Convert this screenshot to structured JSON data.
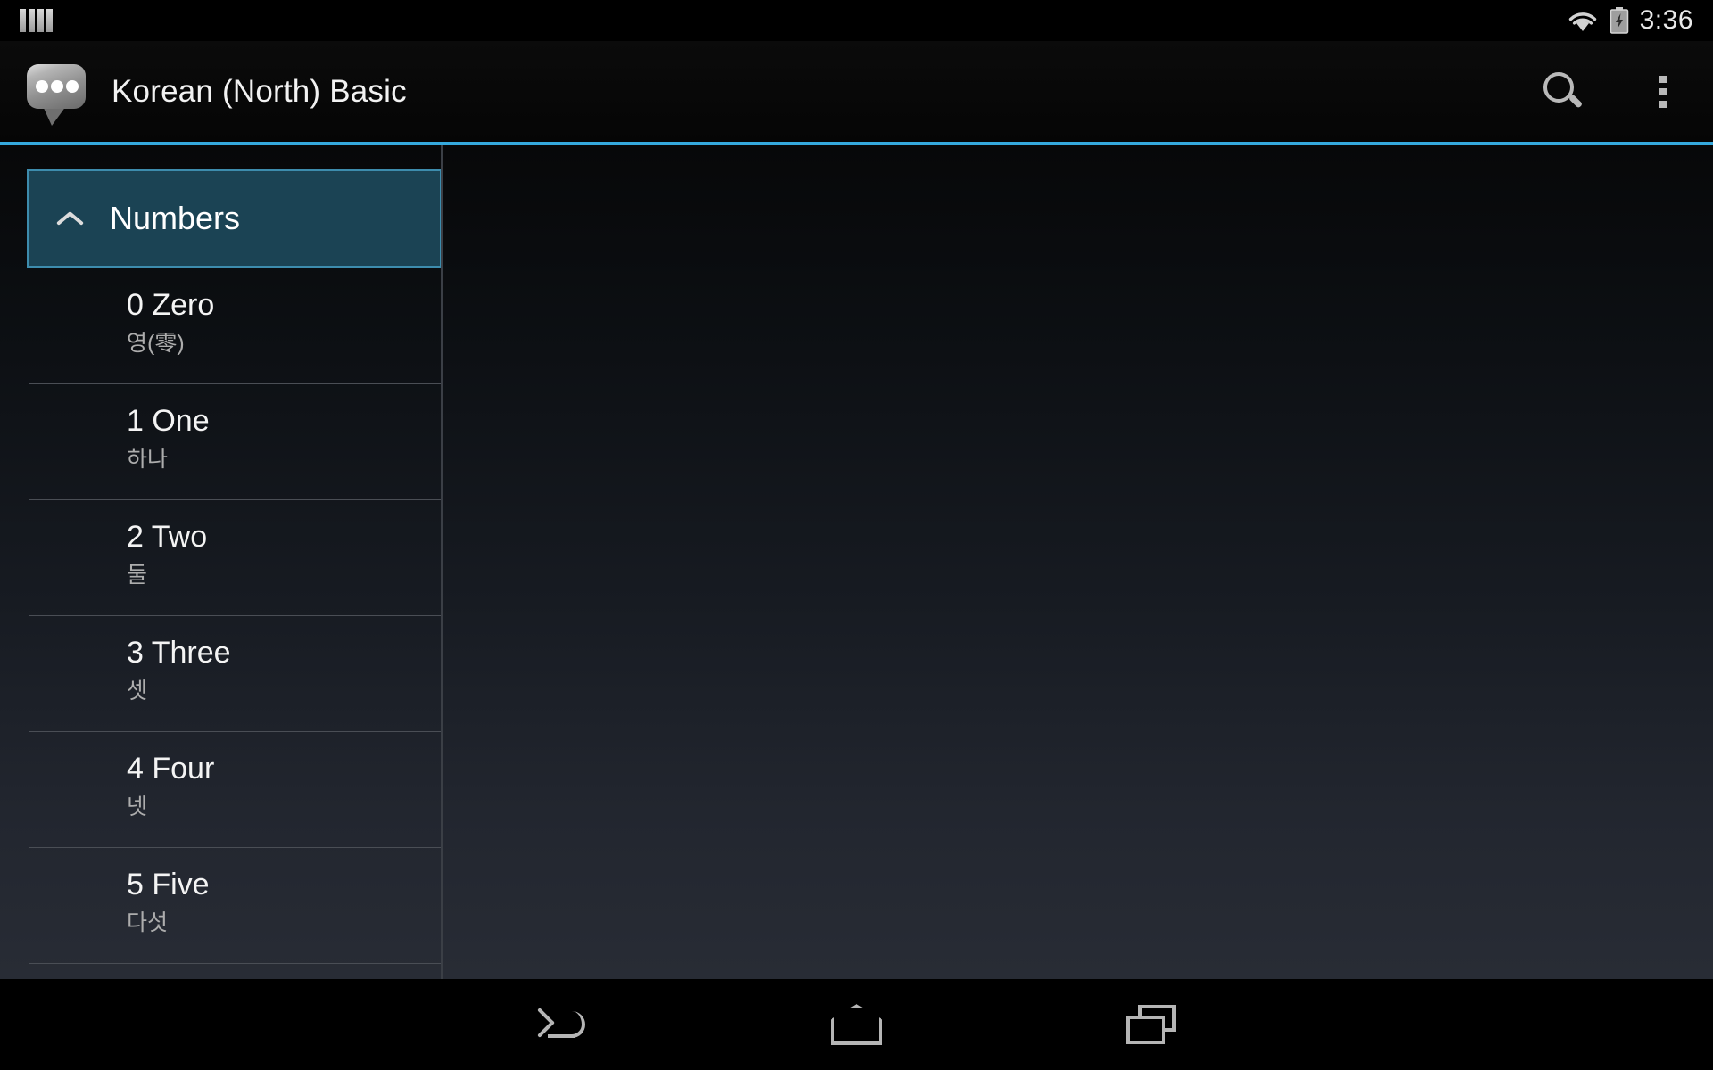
{
  "status_bar": {
    "notification_icon": "notification-bars-icon",
    "wifi_icon": "wifi-icon",
    "battery_icon": "battery-charging-icon",
    "time": "3:36"
  },
  "action_bar": {
    "app_icon": "speech-bubble-icon",
    "title": "Korean (North) Basic",
    "search_icon": "search-icon",
    "overflow_icon": "overflow-menu-icon",
    "accent_color": "#35a9dd"
  },
  "list": {
    "group": {
      "label": "Numbers",
      "expanded": true,
      "chevron_icon": "chevron-up-icon",
      "fill_color": "#1b4354",
      "border_color": "#3d8cad"
    },
    "items": [
      {
        "title": "0 Zero",
        "subtitle": "영(零)"
      },
      {
        "title": "1 One",
        "subtitle": "하나"
      },
      {
        "title": "2 Two",
        "subtitle": "둘"
      },
      {
        "title": "3 Three",
        "subtitle": "셋"
      },
      {
        "title": "4 Four",
        "subtitle": "넷"
      },
      {
        "title": "5 Five",
        "subtitle": "다섯"
      }
    ]
  },
  "detail_pane": {
    "content": ""
  },
  "nav_bar": {
    "back_icon": "back-arrow-icon",
    "home_icon": "home-icon",
    "recents_icon": "recent-apps-icon"
  }
}
